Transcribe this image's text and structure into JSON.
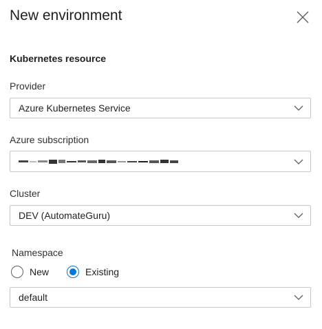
{
  "panel": {
    "title": "New environment",
    "section_title": "Kubernetes resource"
  },
  "provider": {
    "label": "Provider",
    "value": "Azure Kubernetes Service"
  },
  "subscription": {
    "label": "Azure subscription",
    "value_redacted": true
  },
  "cluster": {
    "label": "Cluster",
    "value": "DEV (AutomateGuru)"
  },
  "namespace": {
    "label": "Namespace",
    "options": [
      {
        "label": "New",
        "selected": false
      },
      {
        "label": "Existing",
        "selected": true
      }
    ],
    "value": "default"
  },
  "colors": {
    "accent": "#0078d4",
    "border": "#c8c6c4",
    "text": "#201f1e"
  },
  "icons": {
    "close": "close-icon",
    "dropdown": "chevron-down-icon"
  }
}
